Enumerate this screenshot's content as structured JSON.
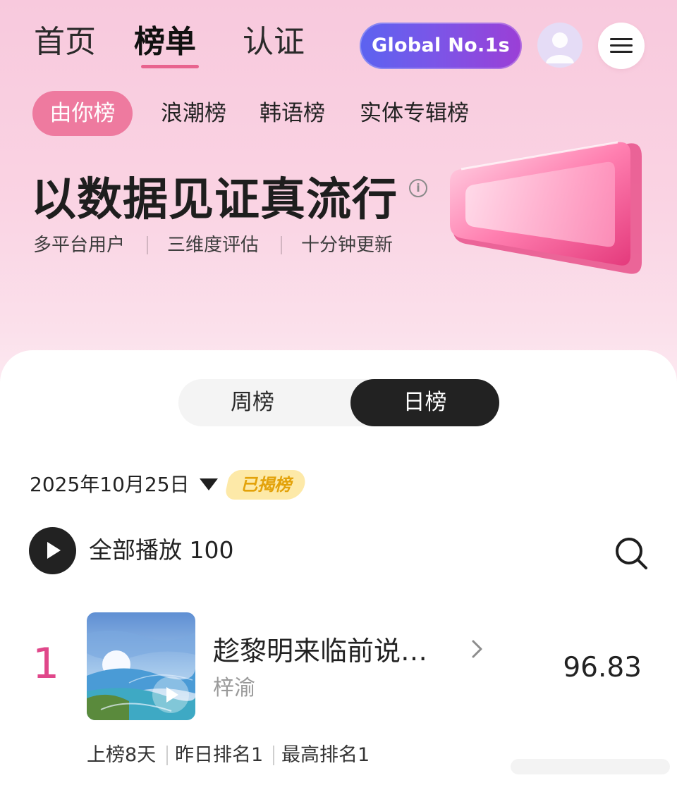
{
  "nav": {
    "items": [
      "首页",
      "榜单",
      "认证"
    ],
    "global_button": "Global No.1s"
  },
  "sub_tabs": {
    "active": "由你榜",
    "others": [
      "浪潮榜",
      "韩语榜",
      "实体专辑榜"
    ]
  },
  "hero": {
    "title": "以数据见证真流行",
    "info_icon": "i",
    "features": [
      "多平台用户",
      "三维度评估",
      "十分钟更新"
    ]
  },
  "period_toggle": {
    "options": [
      "周榜",
      "日榜"
    ],
    "selected": "日榜"
  },
  "chart_date": {
    "date": "2025年10月25日",
    "status_badge": "已揭榜"
  },
  "play_all": {
    "label": "全部播放 100"
  },
  "entries": [
    {
      "rank": "1",
      "title": "趁黎明来临前说…",
      "artist": "梓渝",
      "score": "96.83",
      "days_on_chart": "上榜8天",
      "yesterday_rank": "昨日排名1",
      "peak_rank": "最高排名1"
    }
  ],
  "colors": {
    "accent_pink": "#ee7a9f",
    "rank_color": "#e0478a",
    "global_gradient_start": "#5b63f0",
    "global_gradient_end": "#9b3fd6",
    "badge_bg": "#fde9a8",
    "badge_text": "#e3a20a"
  }
}
